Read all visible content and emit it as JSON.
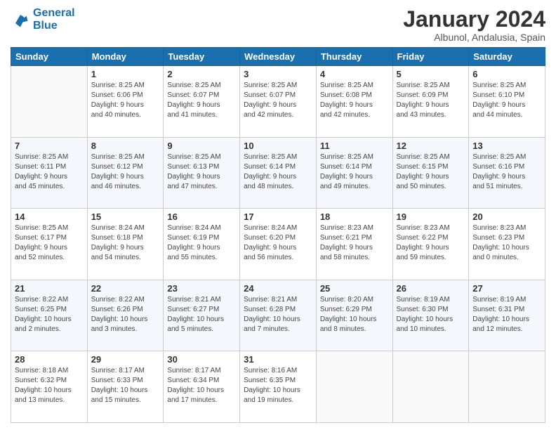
{
  "header": {
    "logo_line1": "General",
    "logo_line2": "Blue",
    "title": "January 2024",
    "subtitle": "Albunol, Andalusia, Spain"
  },
  "days_of_week": [
    "Sunday",
    "Monday",
    "Tuesday",
    "Wednesday",
    "Thursday",
    "Friday",
    "Saturday"
  ],
  "weeks": [
    [
      {
        "day": "",
        "info": ""
      },
      {
        "day": "1",
        "info": "Sunrise: 8:25 AM\nSunset: 6:06 PM\nDaylight: 9 hours\nand 40 minutes."
      },
      {
        "day": "2",
        "info": "Sunrise: 8:25 AM\nSunset: 6:07 PM\nDaylight: 9 hours\nand 41 minutes."
      },
      {
        "day": "3",
        "info": "Sunrise: 8:25 AM\nSunset: 6:07 PM\nDaylight: 9 hours\nand 42 minutes."
      },
      {
        "day": "4",
        "info": "Sunrise: 8:25 AM\nSunset: 6:08 PM\nDaylight: 9 hours\nand 42 minutes."
      },
      {
        "day": "5",
        "info": "Sunrise: 8:25 AM\nSunset: 6:09 PM\nDaylight: 9 hours\nand 43 minutes."
      },
      {
        "day": "6",
        "info": "Sunrise: 8:25 AM\nSunset: 6:10 PM\nDaylight: 9 hours\nand 44 minutes."
      }
    ],
    [
      {
        "day": "7",
        "info": "Sunrise: 8:25 AM\nSunset: 6:11 PM\nDaylight: 9 hours\nand 45 minutes."
      },
      {
        "day": "8",
        "info": "Sunrise: 8:25 AM\nSunset: 6:12 PM\nDaylight: 9 hours\nand 46 minutes."
      },
      {
        "day": "9",
        "info": "Sunrise: 8:25 AM\nSunset: 6:13 PM\nDaylight: 9 hours\nand 47 minutes."
      },
      {
        "day": "10",
        "info": "Sunrise: 8:25 AM\nSunset: 6:14 PM\nDaylight: 9 hours\nand 48 minutes."
      },
      {
        "day": "11",
        "info": "Sunrise: 8:25 AM\nSunset: 6:14 PM\nDaylight: 9 hours\nand 49 minutes."
      },
      {
        "day": "12",
        "info": "Sunrise: 8:25 AM\nSunset: 6:15 PM\nDaylight: 9 hours\nand 50 minutes."
      },
      {
        "day": "13",
        "info": "Sunrise: 8:25 AM\nSunset: 6:16 PM\nDaylight: 9 hours\nand 51 minutes."
      }
    ],
    [
      {
        "day": "14",
        "info": "Sunrise: 8:25 AM\nSunset: 6:17 PM\nDaylight: 9 hours\nand 52 minutes."
      },
      {
        "day": "15",
        "info": "Sunrise: 8:24 AM\nSunset: 6:18 PM\nDaylight: 9 hours\nand 54 minutes."
      },
      {
        "day": "16",
        "info": "Sunrise: 8:24 AM\nSunset: 6:19 PM\nDaylight: 9 hours\nand 55 minutes."
      },
      {
        "day": "17",
        "info": "Sunrise: 8:24 AM\nSunset: 6:20 PM\nDaylight: 9 hours\nand 56 minutes."
      },
      {
        "day": "18",
        "info": "Sunrise: 8:23 AM\nSunset: 6:21 PM\nDaylight: 9 hours\nand 58 minutes."
      },
      {
        "day": "19",
        "info": "Sunrise: 8:23 AM\nSunset: 6:22 PM\nDaylight: 9 hours\nand 59 minutes."
      },
      {
        "day": "20",
        "info": "Sunrise: 8:23 AM\nSunset: 6:23 PM\nDaylight: 10 hours\nand 0 minutes."
      }
    ],
    [
      {
        "day": "21",
        "info": "Sunrise: 8:22 AM\nSunset: 6:25 PM\nDaylight: 10 hours\nand 2 minutes."
      },
      {
        "day": "22",
        "info": "Sunrise: 8:22 AM\nSunset: 6:26 PM\nDaylight: 10 hours\nand 3 minutes."
      },
      {
        "day": "23",
        "info": "Sunrise: 8:21 AM\nSunset: 6:27 PM\nDaylight: 10 hours\nand 5 minutes."
      },
      {
        "day": "24",
        "info": "Sunrise: 8:21 AM\nSunset: 6:28 PM\nDaylight: 10 hours\nand 7 minutes."
      },
      {
        "day": "25",
        "info": "Sunrise: 8:20 AM\nSunset: 6:29 PM\nDaylight: 10 hours\nand 8 minutes."
      },
      {
        "day": "26",
        "info": "Sunrise: 8:19 AM\nSunset: 6:30 PM\nDaylight: 10 hours\nand 10 minutes."
      },
      {
        "day": "27",
        "info": "Sunrise: 8:19 AM\nSunset: 6:31 PM\nDaylight: 10 hours\nand 12 minutes."
      }
    ],
    [
      {
        "day": "28",
        "info": "Sunrise: 8:18 AM\nSunset: 6:32 PM\nDaylight: 10 hours\nand 13 minutes."
      },
      {
        "day": "29",
        "info": "Sunrise: 8:17 AM\nSunset: 6:33 PM\nDaylight: 10 hours\nand 15 minutes."
      },
      {
        "day": "30",
        "info": "Sunrise: 8:17 AM\nSunset: 6:34 PM\nDaylight: 10 hours\nand 17 minutes."
      },
      {
        "day": "31",
        "info": "Sunrise: 8:16 AM\nSunset: 6:35 PM\nDaylight: 10 hours\nand 19 minutes."
      },
      {
        "day": "",
        "info": ""
      },
      {
        "day": "",
        "info": ""
      },
      {
        "day": "",
        "info": ""
      }
    ]
  ]
}
